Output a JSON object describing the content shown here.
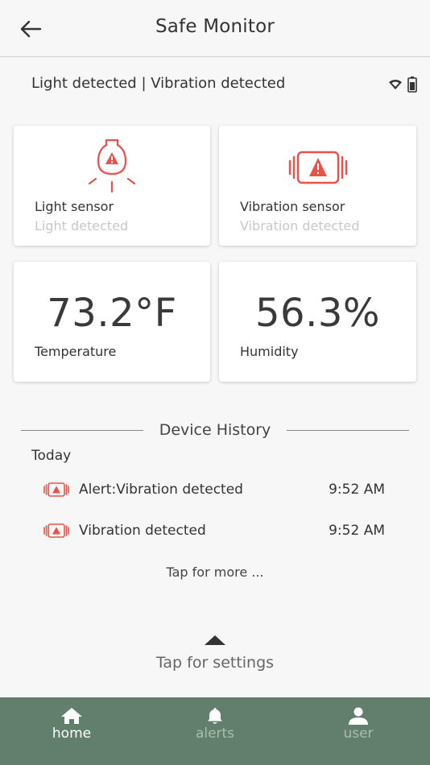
{
  "header": {
    "title": "Safe Monitor"
  },
  "status": {
    "text": "Light detected | Vibration detected"
  },
  "sensors": {
    "light": {
      "label": "Light sensor",
      "status": "Light detected"
    },
    "vibration": {
      "label": "Vibration sensor",
      "status": "Vibration detected"
    }
  },
  "readings": {
    "temperature": {
      "value": "73.2°F",
      "label": "Temperature"
    },
    "humidity": {
      "value": "56.3%",
      "label": "Humidity"
    }
  },
  "history": {
    "title": "Device History",
    "day": "Today",
    "items": [
      {
        "text": "Alert:Vibration detected",
        "time": "9:52 AM"
      },
      {
        "text": "Vibration detected",
        "time": "9:52 AM"
      }
    ],
    "more": "Tap for more ..."
  },
  "settings": {
    "label": "Tap for settings"
  },
  "tabs": [
    {
      "label": "home",
      "icon": "home-icon",
      "active": true
    },
    {
      "label": "alerts",
      "icon": "bell-icon",
      "active": false
    },
    {
      "label": "user",
      "icon": "user-icon",
      "active": false
    }
  ],
  "colors": {
    "alert_red": "#e8524a",
    "tabbar": "#617f6c",
    "tab_active": "#ffffff",
    "tab_inactive": "#a9bdb0"
  }
}
